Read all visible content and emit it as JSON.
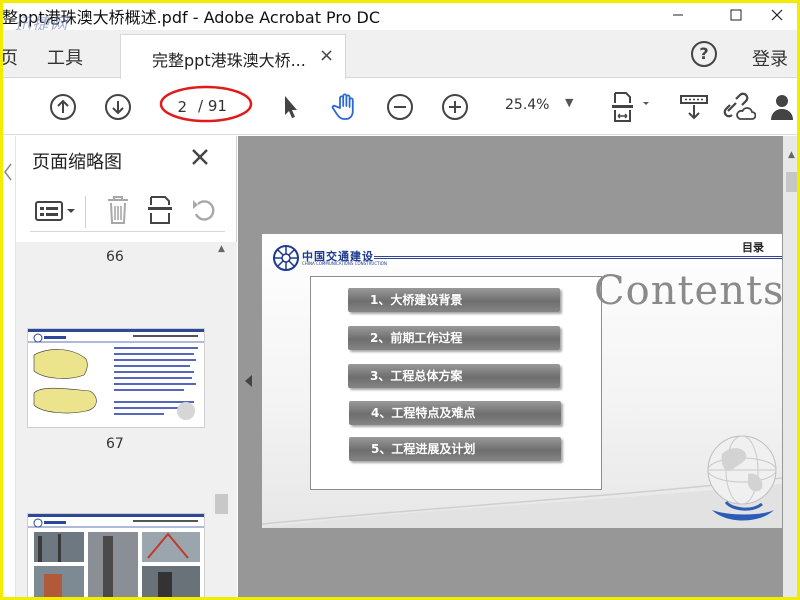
{
  "titlebar": {
    "title": "整ppt港珠澳大桥概述.pdf - Adobe Acrobat Pro DC",
    "watermark": "迅捷网"
  },
  "tabs": {
    "home": "页",
    "tools": "工具",
    "document": "完整ppt港珠澳大桥...",
    "close": "×",
    "help": "?",
    "login": "登录"
  },
  "toolbar": {
    "page_current": "2",
    "page_total": "/ 91",
    "zoom": "25.4%"
  },
  "sidepanel": {
    "title": "页面缩略图",
    "thumbnails": [
      {
        "page": "66"
      },
      {
        "page": "67"
      }
    ]
  },
  "slide": {
    "logo_cn": "中国交通建设",
    "logo_en": "CHINA COMMUNICATIONS CONSTRUCTION",
    "section_label": "目录",
    "contents_word": "Contents",
    "menu": [
      "1、大桥建设背景",
      "2、前期工作过程",
      "3、工程总体方案",
      "4、工程特点及难点",
      "5、工程进展及计划"
    ]
  },
  "colors": {
    "frame": "#f2ec00",
    "annotation_oval": "#e01b1b",
    "hand_tool_active": "#2a6ad8",
    "doc_background": "#979797",
    "logo_blue": "#1d3a8f"
  },
  "icons": [
    "minimize-icon",
    "maximize-icon",
    "close-icon",
    "help-icon",
    "page-up-icon",
    "page-down-icon",
    "select-cursor-icon",
    "hand-tool-icon",
    "zoom-out-icon",
    "zoom-in-icon",
    "fit-page-icon",
    "scroll-mode-icon",
    "cloud-link-icon",
    "user-add-icon",
    "thumbnail-options-icon",
    "delete-page-icon",
    "insert-page-icon",
    "rotate-page-icon"
  ]
}
